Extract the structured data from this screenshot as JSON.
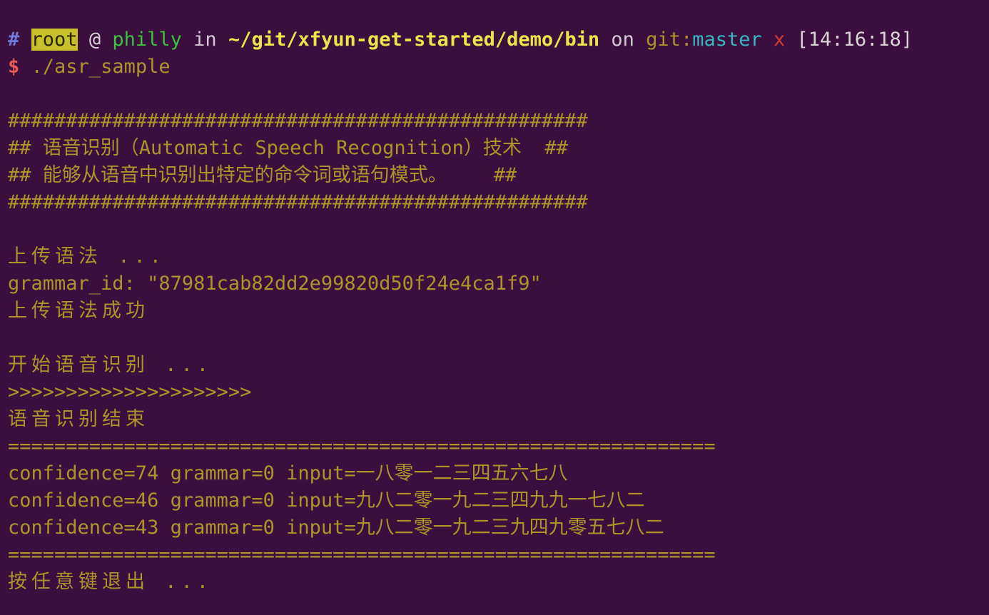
{
  "prompt": {
    "hash": "#",
    "user": "root",
    "at": "@",
    "host": "philly",
    "in": "in",
    "path": "~/git/xfyun-get-started/demo/bin",
    "on": "on",
    "git_label": "git:",
    "branch": "master",
    "dirty": "x",
    "time": "[14:16:18]"
  },
  "command": {
    "symbol": "$",
    "text": "./asr_sample"
  },
  "output": {
    "banner_top": "##################################################",
    "banner_line1": "## 语音识别（Automatic Speech Recognition）技术  ##",
    "banner_line2": "## 能够从语音中识别出特定的命令词或语句模式。    ##",
    "banner_bottom": "##################################################",
    "upload_start": "上传语法 ...",
    "grammar_id": "grammar_id: \"87981cab82dd2e99820d50f24e4ca1f9\"",
    "upload_success": "上传语法成功",
    "recog_start": "开始语音识别 ...",
    "progress": ">>>>>>>>>>>>>>>>>>>>>",
    "recog_end": "语音识别结束",
    "divider": "=============================================================",
    "results": [
      "confidence=74 grammar=0 input=一八零一二三四五六七八",
      "confidence=46 grammar=0 input=九八二零一九二三四九九一七八二",
      "confidence=43 grammar=0 input=九八二零一九二三九四九零五七八二"
    ],
    "exit_prompt": "按任意键退出 ..."
  }
}
